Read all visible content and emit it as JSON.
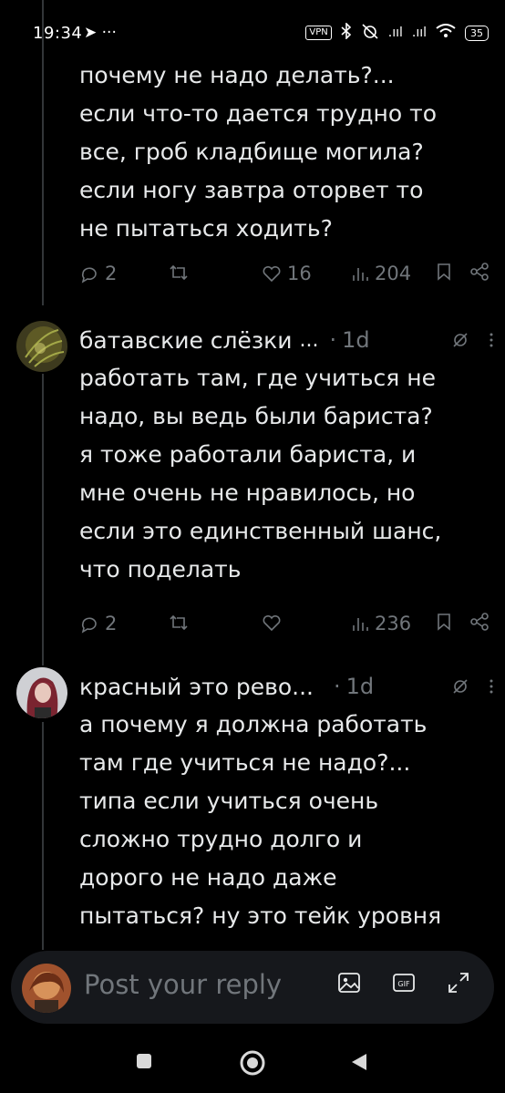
{
  "status_bar": {
    "time": "19:34",
    "left_icons": "➤ ···",
    "vpn": "VPN",
    "signal_1": ".ııl",
    "signal_2": ".ııl",
    "battery": "35"
  },
  "posts": [
    {
      "text": "почему не надо делать?...\nесли что-то дается трудно то\nвсе, гроб кладбище могила?\nесли ногу завтра оторвет то\nне пытаться ходить?",
      "replies": "2",
      "reposts": "",
      "likes": "16",
      "views": "204"
    },
    {
      "author": "батавские слёзки",
      "author_more": "...",
      "time": "1d",
      "text": "работать там, где учиться не\nнадо, вы ведь были бариста?\nя тоже работали бариста, и\nмне очень не нравилось, но\nесли это единственный шанс,\nчто поделать",
      "replies": "2",
      "reposts": "",
      "likes": "",
      "views": "236"
    },
    {
      "author": "красный это рево...",
      "time": "1d",
      "text": "а почему я должна работать\nтам где учиться не надо?...\nтипа если учиться очень\nсложно трудно долго и\nдорого не надо даже\nпытаться? ну это тейк уровня"
    }
  ],
  "reply_bar": {
    "placeholder": "Post your reply",
    "gif_label": "GIF"
  },
  "icons": {
    "reply": "reply-icon",
    "repost": "repost-icon",
    "like": "heart-icon",
    "views": "views-icon",
    "bookmark": "bookmark-icon",
    "share": "share-icon",
    "grok": "grok-icon",
    "more": "more-icon"
  },
  "colors": {
    "background": "#000000",
    "text": "#e7e9ea",
    "muted": "#71767b",
    "reply_bar": "#16181c"
  }
}
